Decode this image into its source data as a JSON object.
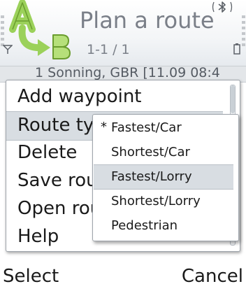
{
  "title_bar": {
    "title": "Plan a route",
    "subtitle": "1-1 / 1",
    "app_icon": "route-planner-a-to-b-icon",
    "status_icons": [
      "bluetooth-icon",
      "antenna-icon",
      "battery-icon"
    ]
  },
  "list": {
    "rows": [
      {
        "text": "1  Sonning, GBR [11.09 08:4"
      }
    ]
  },
  "options_menu": {
    "items": [
      {
        "label": "Add waypoint"
      },
      {
        "label": "Route ty"
      },
      {
        "label": "Delete"
      },
      {
        "label": "Save rou"
      },
      {
        "label": "Open rou"
      },
      {
        "label": "Help"
      }
    ],
    "highlighted_index": 1
  },
  "route_type_submenu": {
    "items": [
      {
        "mark": "*",
        "label": "Fastest/Car"
      },
      {
        "mark": "",
        "label": "Shortest/Car"
      },
      {
        "mark": "",
        "label": "Fastest/Lorry"
      },
      {
        "mark": "",
        "label": "Shortest/Lorry"
      },
      {
        "mark": "",
        "label": "Pedestrian"
      }
    ],
    "checked_index": 0,
    "highlighted_index": 2
  },
  "softkeys": {
    "left": "Select",
    "right": "Cancel"
  },
  "colors": {
    "title_text": "#7a7f88",
    "highlight": "#d8dde2",
    "icon_green": "#9bd15a"
  }
}
